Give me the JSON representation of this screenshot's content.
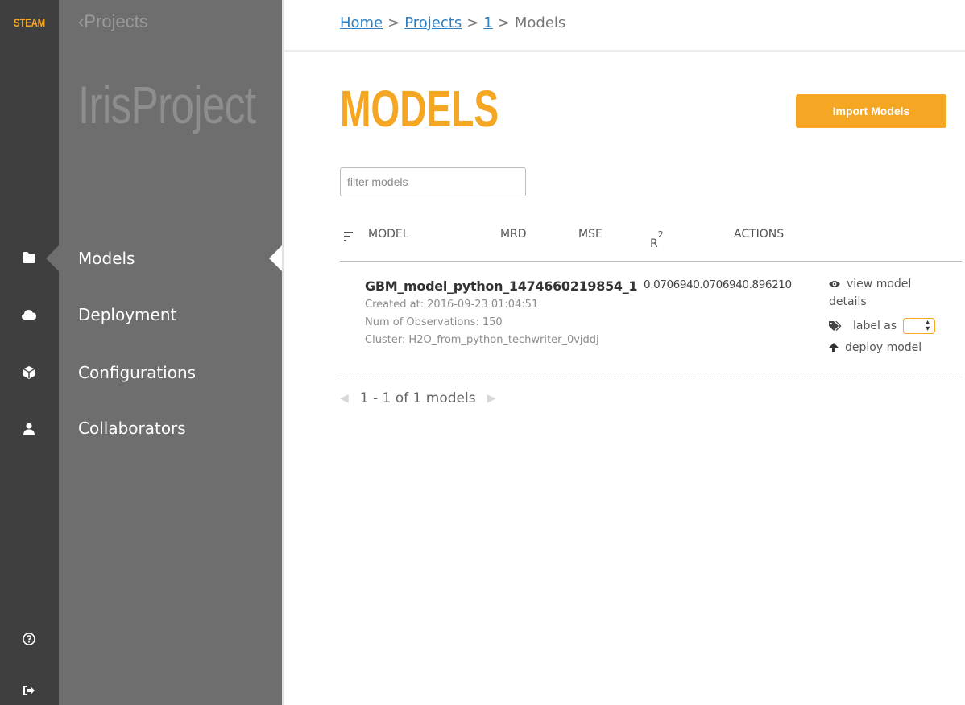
{
  "brand": "STEAM",
  "sidebar": {
    "back_label": "Projects",
    "project_name": "IrisProject",
    "items": [
      {
        "label": "Models",
        "icon": "folder-icon",
        "active": true
      },
      {
        "label": "Deployment",
        "icon": "cloud-icon"
      },
      {
        "label": "Configurations",
        "icon": "cube-icon"
      },
      {
        "label": "Collaborators",
        "icon": "user-icon"
      }
    ],
    "footer_icons": [
      "help-icon",
      "logout-icon"
    ]
  },
  "breadcrumb": {
    "home": "Home",
    "projects": "Projects",
    "project_id": "1",
    "current": "Models",
    "separator": ">"
  },
  "main": {
    "title": "MODELS",
    "import_button": "Import Models",
    "filter_placeholder": "filter models",
    "columns": {
      "model": "MODEL",
      "mrd": "MRD",
      "mse": "MSE",
      "r2": "R",
      "r2_sup": "2",
      "actions": "ACTIONS"
    },
    "rows": [
      {
        "name": "GBM_model_python_1474660219854_1",
        "created_at": "Created at: 2016-09-23 01:04:51",
        "observations": "Num of Observations: 150",
        "cluster": "Cluster: H2O_from_python_techwriter_0vjddj",
        "metrics": "0.0706940.0706940.896210",
        "actions": {
          "view_line1": "view model",
          "view_line2": "details",
          "label": "label as",
          "deploy": "deploy model"
        }
      }
    ],
    "pagination": "1 - 1 of 1 models"
  },
  "colors": {
    "accent": "#f5a623",
    "rail": "#3f3f3f",
    "sidebar": "#6e6e6e",
    "link": "#2d7fc1"
  }
}
